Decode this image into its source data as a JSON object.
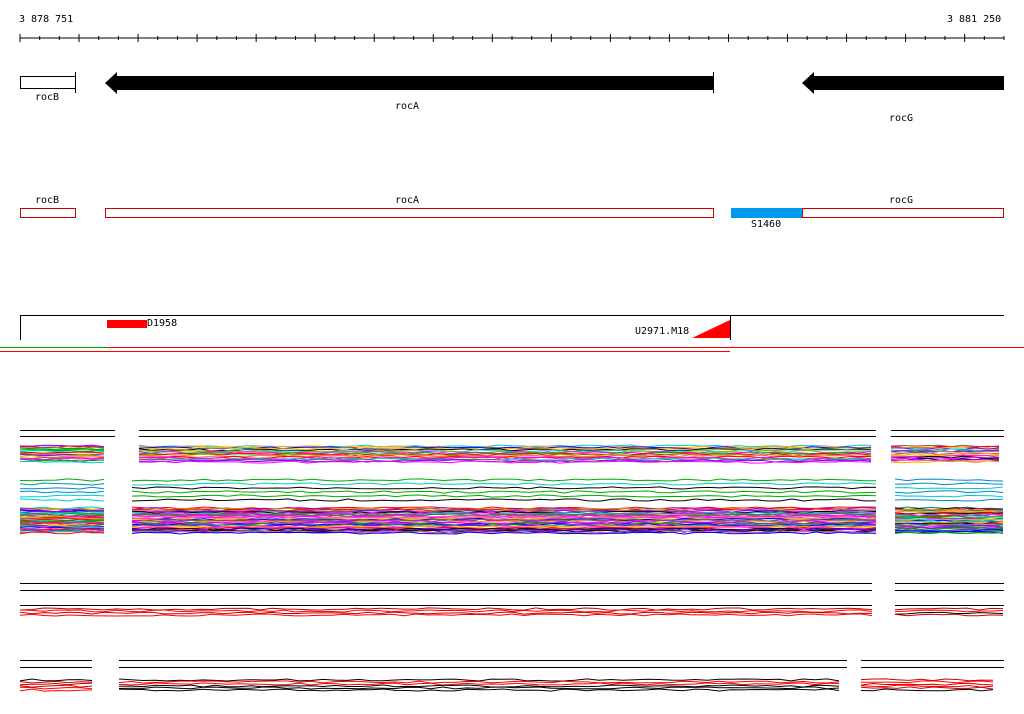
{
  "ruler": {
    "start_label": "3 878 751",
    "end_label": "3 881 250"
  },
  "genes": [
    {
      "name": "rocB",
      "label": "rocB"
    },
    {
      "name": "rocA",
      "label": "rocA"
    },
    {
      "name": "rocG",
      "label": "rocG"
    }
  ],
  "annotation_track": {
    "boxes": [
      {
        "label": "rocB"
      },
      {
        "label": "rocA"
      },
      {
        "label": "rocG"
      }
    ],
    "segment_label": "S1460",
    "segment_color": "#0099ee",
    "box_color": "#cc0000"
  },
  "feature_track": {
    "left_feature": "D1958",
    "right_feature": "U2971.M18",
    "feature_color": "#ff0000"
  },
  "colors": {
    "arrow": "#000000",
    "expression_palette": [
      "#000000",
      "#ff0000",
      "#00aa00",
      "#0000ff",
      "#ff00ff",
      "#00cccc",
      "#ffaa00",
      "#8800ff",
      "#aaaa00",
      "#ff6699",
      "#008888",
      "#666666"
    ]
  }
}
